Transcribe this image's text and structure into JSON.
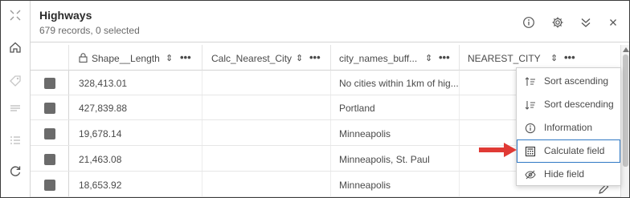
{
  "header": {
    "title": "Highways",
    "subtitle": "679 records, 0 selected"
  },
  "table": {
    "columns": [
      {
        "label": "Shape__Length",
        "locked": true
      },
      {
        "label": "Calc_Nearest_City",
        "locked": false
      },
      {
        "label": "city_names_buff...",
        "locked": false
      },
      {
        "label": "NEAREST_CITY",
        "locked": false
      }
    ],
    "sort_glyph": "⇕",
    "more_glyph": "•••",
    "rows": [
      {
        "shape_length": "328,413.01",
        "calc_nearest_city": "",
        "city_names": "No cities within 1km of hig...",
        "nearest_city": ""
      },
      {
        "shape_length": "427,839.88",
        "calc_nearest_city": "",
        "city_names": "Portland",
        "nearest_city": ""
      },
      {
        "shape_length": "19,678.14",
        "calc_nearest_city": "",
        "city_names": "Minneapolis",
        "nearest_city": ""
      },
      {
        "shape_length": "21,463.08",
        "calc_nearest_city": "",
        "city_names": "Minneapolis, St. Paul",
        "nearest_city": ""
      },
      {
        "shape_length": "18,653.92",
        "calc_nearest_city": "",
        "city_names": "Minneapolis",
        "nearest_city": ""
      }
    ]
  },
  "menu": {
    "items": [
      {
        "label": "Sort ascending",
        "icon": "sort-ascending-icon"
      },
      {
        "label": "Sort descending",
        "icon": "sort-descending-icon"
      },
      {
        "label": "Information",
        "icon": "information-icon"
      },
      {
        "label": "Calculate field",
        "icon": "calculator-icon",
        "highlighted": true
      },
      {
        "label": "Hide field",
        "icon": "hide-icon"
      }
    ]
  },
  "colors": {
    "accent": "#2f78c4",
    "arrow": "#e03a35",
    "checkbox": "#6b6b6b"
  }
}
